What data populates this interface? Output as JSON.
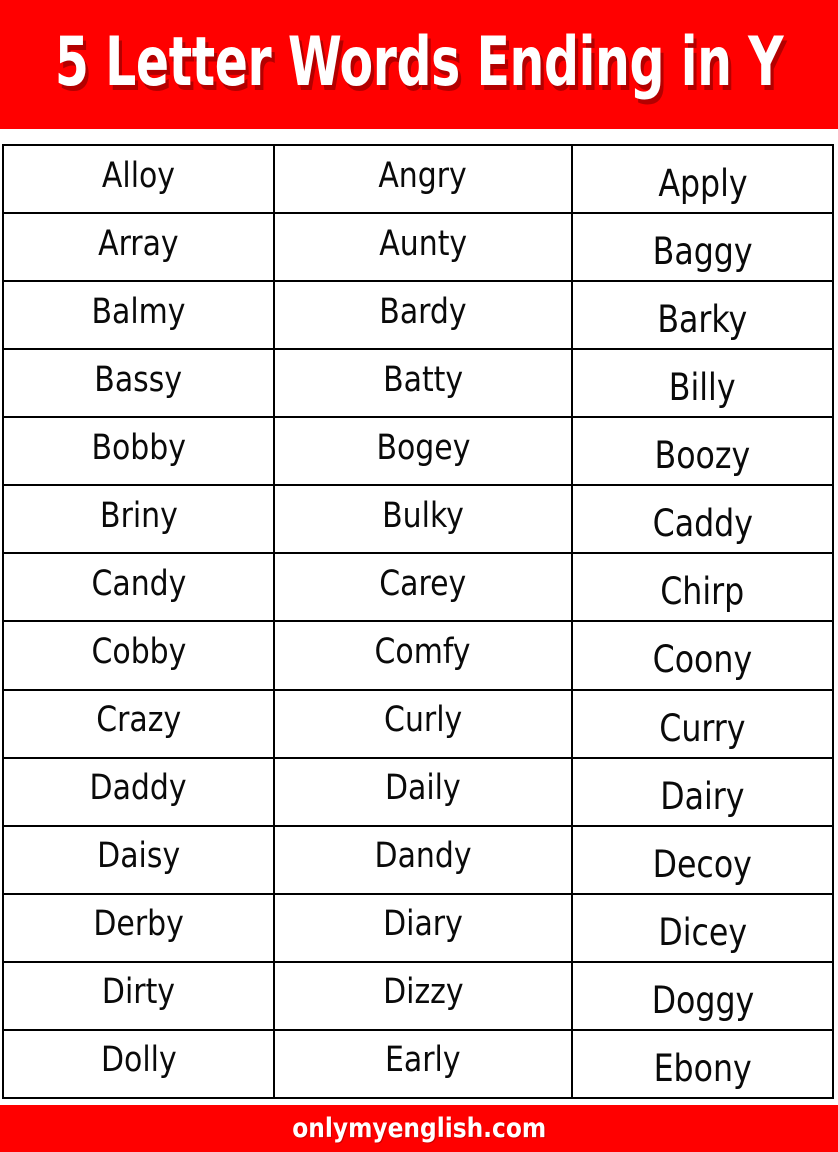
{
  "header": {
    "title": "5 Letter Words Ending in Y",
    "background_color": "#ff0000",
    "text_color": "#ffffff",
    "shadow_color": "#b30000"
  },
  "table": {
    "column_count": 3,
    "row_count": 14,
    "border_color": "#000000",
    "text_color": "#0a0a0a",
    "rows": [
      {
        "c1": "Alloy",
        "c2": "Angry",
        "c3": "Apply"
      },
      {
        "c1": "Array",
        "c2": "Aunty",
        "c3": "Baggy"
      },
      {
        "c1": "Balmy",
        "c2": "Bardy",
        "c3": "Barky"
      },
      {
        "c1": "Bassy",
        "c2": "Batty",
        "c3": "Billy"
      },
      {
        "c1": "Bobby",
        "c2": "Bogey",
        "c3": "Boozy"
      },
      {
        "c1": "Briny",
        "c2": "Bulky",
        "c3": "Caddy"
      },
      {
        "c1": "Candy",
        "c2": "Carey",
        "c3": "Chirp"
      },
      {
        "c1": "Cobby",
        "c2": "Comfy",
        "c3": "Coony"
      },
      {
        "c1": "Crazy",
        "c2": "Curly",
        "c3": "Curry"
      },
      {
        "c1": "Daddy",
        "c2": "Daily",
        "c3": "Dairy"
      },
      {
        "c1": "Daisy",
        "c2": "Dandy",
        "c3": "Decoy"
      },
      {
        "c1": "Derby",
        "c2": "Diary",
        "c3": "Dicey"
      },
      {
        "c1": "Dirty",
        "c2": "Dizzy",
        "c3": "Doggy"
      },
      {
        "c1": "Dolly",
        "c2": "Early",
        "c3": "Ebony"
      }
    ]
  },
  "footer": {
    "site": "onlymyenglish.com",
    "background_color": "#ff0000",
    "text_color": "#ffffff"
  }
}
